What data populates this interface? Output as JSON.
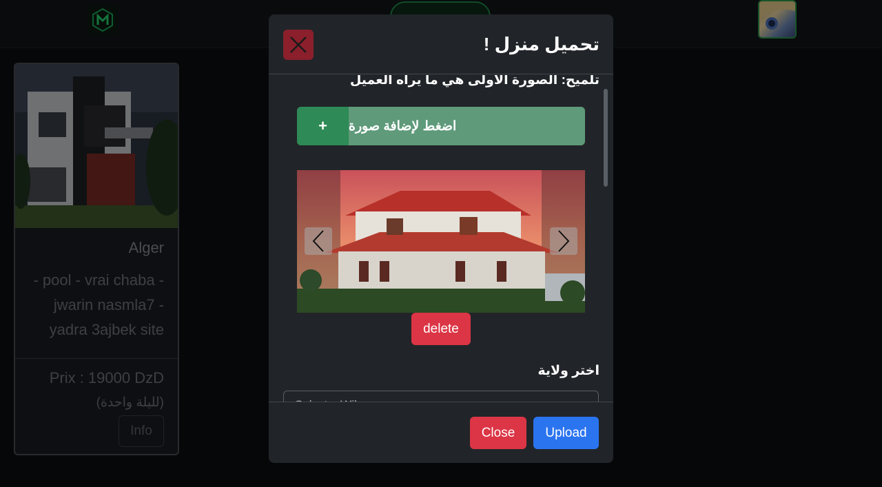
{
  "navbar": {
    "logo_icon": "m-logo-icon",
    "avatar_icon": "anime-avatar"
  },
  "listing_card": {
    "title": "Alger",
    "description": "- pool - vrai chaba - jwarin nasmla7 - yadra 3ajbek site",
    "price": "Prix : 19000 DzD",
    "per_night": "(لليلة واحدة)",
    "info_label": "Info"
  },
  "modal": {
    "title": "تحميل منزل !",
    "hint": "تلميح: الصورة الاولى هي ما يراه العميل",
    "add_photo_label": "اضغط لإضافة صورة",
    "add_photo_icon": "+",
    "delete_label": "delete",
    "wilaya_label": "اختر ولاية",
    "wilaya_select_value": "Select a Wilaya",
    "close_label": "Close",
    "upload_label": "Upload"
  },
  "colors": {
    "modal_bg": "#212529",
    "danger": "#dc3545",
    "primary": "#2b74f0",
    "success": "#2e8a56"
  }
}
